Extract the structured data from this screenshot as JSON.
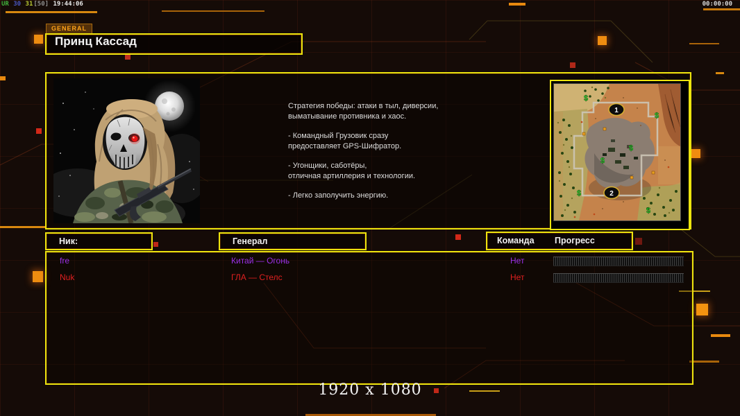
{
  "status": {
    "left": {
      "ur": "UR",
      "num_blue": "30",
      "num_green": "31",
      "bracket": "[50]",
      "time": "19:44:06"
    },
    "timer": "00:00:00"
  },
  "tab": {
    "label": "GENERAL"
  },
  "title": {
    "text": "Принц Кассад"
  },
  "description": {
    "p1": [
      "Стратегия победы: атаки в тыл, диверсии,",
      " выматывание противника и хаос."
    ],
    "p2": [
      "- Командный Грузовик сразу",
      "предоставляет GPS-Шифратор."
    ],
    "p3": [
      "- Угонщики, саботёры,",
      "отличная артиллерия и технологии."
    ],
    "p4": [
      "- Легко заполучить энергию."
    ]
  },
  "map": {
    "marker1": "1",
    "marker2": "2",
    "supply_symbol": "$"
  },
  "table": {
    "headers": {
      "nick": "Ник:",
      "general": "Генерал",
      "team": "Команда",
      "progress": "Прогресс"
    },
    "rows": [
      {
        "nick": "fre",
        "general": "Китай — Огонь",
        "team": "Нет",
        "progress_percent": 0,
        "color": "#9b30e8"
      },
      {
        "nick": "Nuk",
        "general": "ГЛА — Стелс",
        "team": "Нет",
        "progress_percent": 0,
        "color": "#e02020"
      }
    ]
  },
  "footer": {
    "resolution": "1920 x 1080"
  },
  "colors": {
    "accent_yellow": "#ece40e",
    "accent_orange": "#e8890f",
    "grid_red": "#96321a",
    "row1_purple": "#9b30e8",
    "row2_red": "#e02020"
  }
}
